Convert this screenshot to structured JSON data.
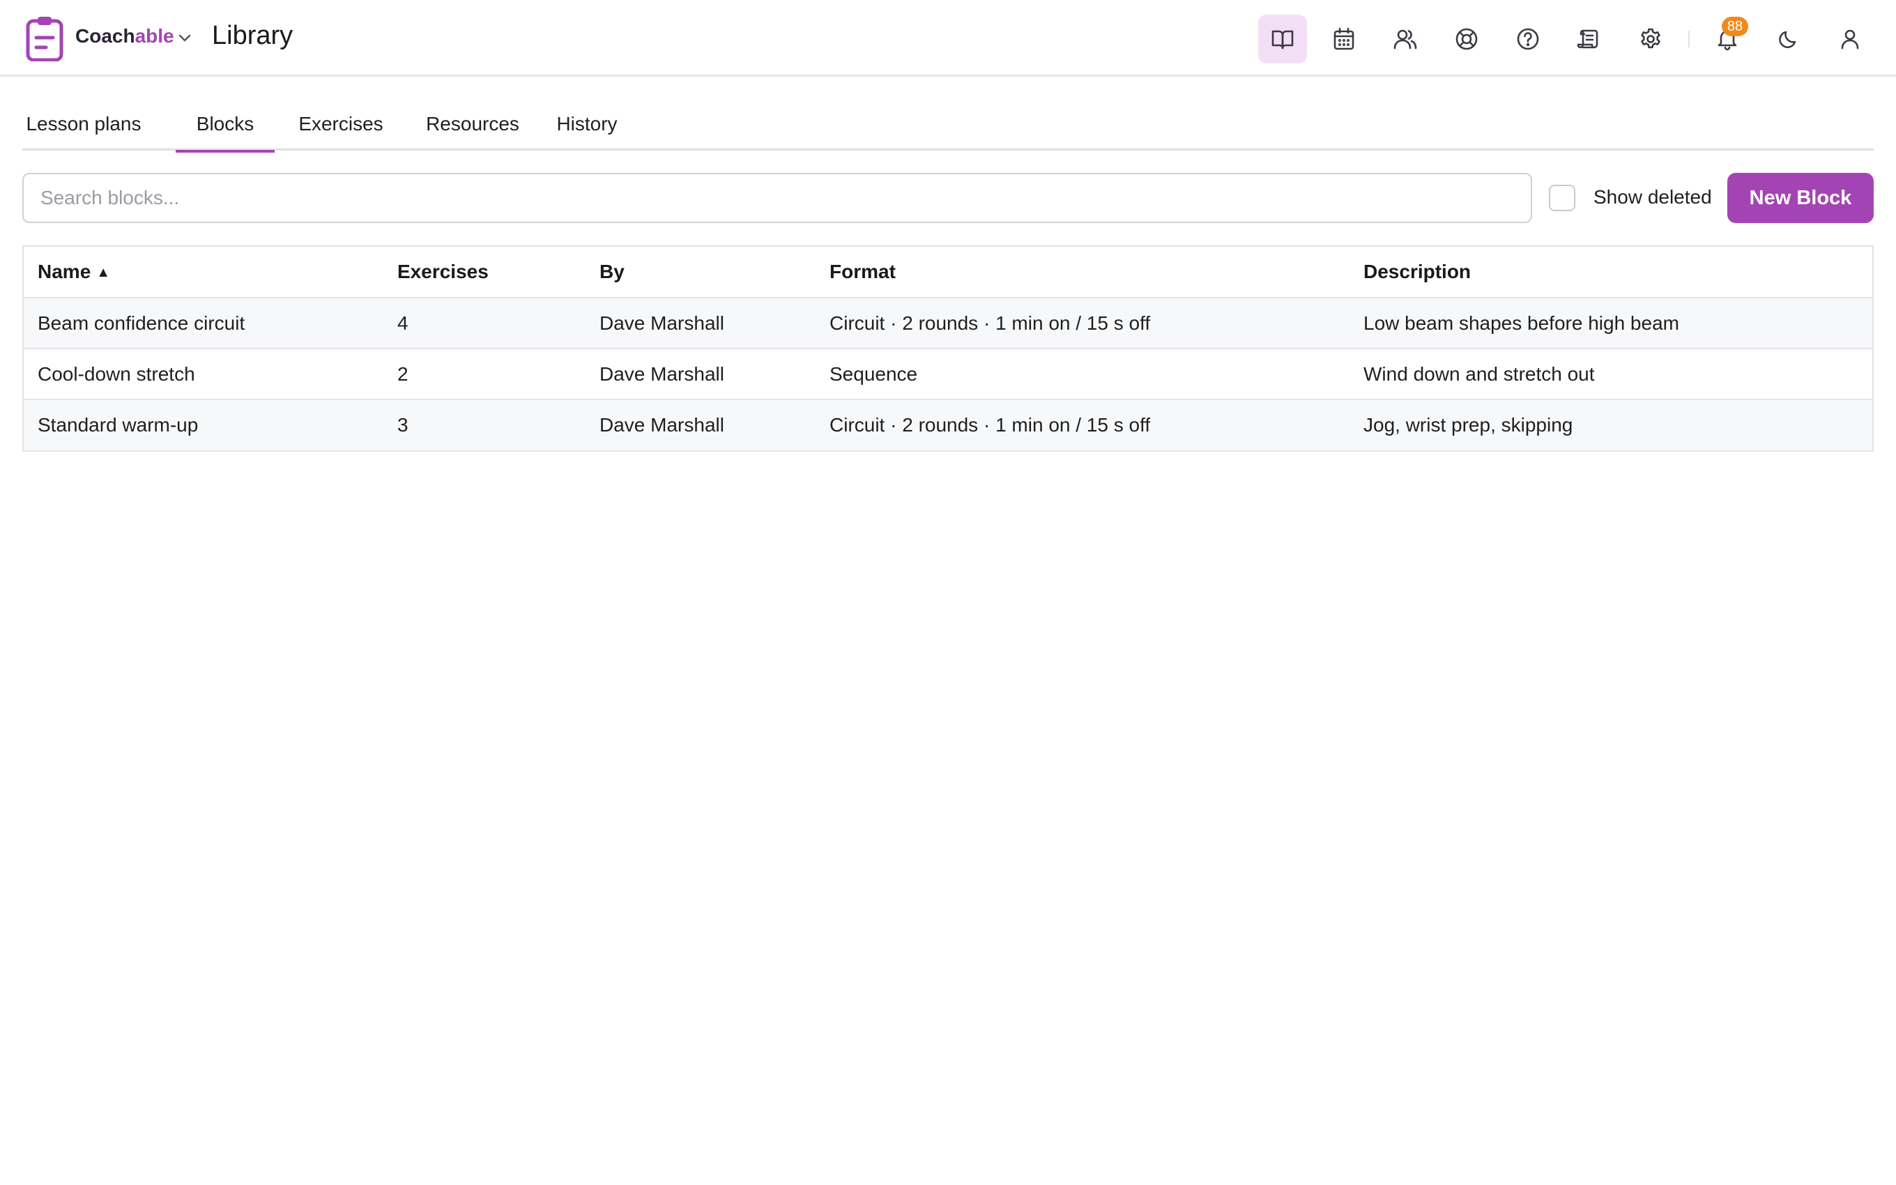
{
  "app": {
    "brand_main": "Coach",
    "brand_accent": "able",
    "page_title": "Library",
    "accent_color": "#a444b4"
  },
  "toolbar": {
    "icons": [
      "library-icon",
      "calendar-icon",
      "users-icon",
      "lifebuoy-icon",
      "help-icon",
      "scroll-icon",
      "gear-icon",
      "bell-icon",
      "moon-icon",
      "user-icon"
    ],
    "active": "library-icon",
    "notification_count": "88"
  },
  "tabs": [
    {
      "label": "Lesson plans",
      "active": false
    },
    {
      "label": "Blocks",
      "active": true
    },
    {
      "label": "Exercises",
      "active": false
    },
    {
      "label": "Resources",
      "active": false
    },
    {
      "label": "History",
      "active": false
    }
  ],
  "controls": {
    "search_placeholder": "Search blocks...",
    "search_value": "",
    "show_deleted_label": "Show deleted",
    "show_deleted_checked": false,
    "new_button_label": "New Block"
  },
  "table": {
    "columns": [
      "Name",
      "Exercises",
      "By",
      "Format",
      "Description"
    ],
    "sort_column": "Name",
    "sort_indicator": "▲",
    "rows": [
      [
        "Beam confidence circuit",
        "4",
        "Dave Marshall",
        "Circuit · 2 rounds · 1 min on / 15 s off",
        "Low beam shapes before high beam"
      ],
      [
        "Cool-down stretch",
        "2",
        "Dave Marshall",
        "Sequence",
        "Wind down and stretch out"
      ],
      [
        "Standard warm-up",
        "3",
        "Dave Marshall",
        "Circuit · 2 rounds · 1 min on / 15 s off",
        "Jog, wrist prep, skipping"
      ]
    ]
  }
}
